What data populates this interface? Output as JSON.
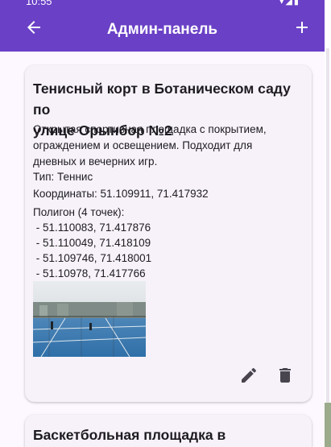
{
  "status_bar": {
    "time": "10:55",
    "icons": "▾◢▮"
  },
  "app_bar": {
    "title": "Админ-панель",
    "back_icon": "arrow-back-icon",
    "add_icon": "plus-icon"
  },
  "cards": [
    {
      "title_line1": "Тенисный корт в Ботаническом саду по",
      "title_line2": "улице Орынбор №2",
      "desc_line1": "Открытая спортивная площадка с покрытием,",
      "desc_line2": "ограждением и освещением. Подходит для",
      "desc_line3": "дневных и вечерних игр.",
      "type": "Тип: Теннис",
      "coords": "Координаты: 51.109911, 71.417932",
      "polygon_header": "Полигон (4 точек):",
      "polygon_points": [
        " - 51.110083, 71.417876",
        " - 51.110049, 71.418109",
        " - 51.109746, 71.418001",
        " - 51.10978, 71.417766"
      ],
      "edit_icon": "pencil-icon",
      "delete_icon": "trash-icon"
    },
    {
      "title_line1": "Баскетбольная площадка в"
    }
  ],
  "colors": {
    "primary": "#6a40c6",
    "card": "#f7f2fa",
    "background": "#fdf7ff"
  }
}
